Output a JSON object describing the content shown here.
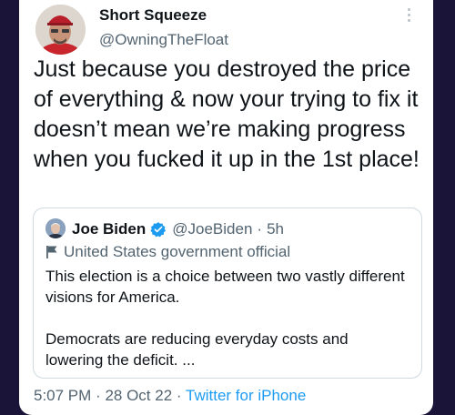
{
  "tweet": {
    "author_name": "Short Squeeze",
    "author_handle": "@OwningTheFloat",
    "text": "Just because you destroyed the price of everything & now your trying to fix it doesn’t mean we’re making progress when you fucked it up in the 1st place!",
    "more_icon": "more-vertical-icon",
    "time": "5:07 PM",
    "date": "28 Oct 22",
    "source": "Twitter for iPhone",
    "separator": "·"
  },
  "quoted_tweet": {
    "author_name": "Joe Biden",
    "author_handle": "@JoeBiden",
    "age": "5h",
    "label": "United States government official",
    "text": "This election is a choice between two vastly different visions for America.\n\nDemocrats are reducing everyday costs and lowering the deficit. ...",
    "verified_icon": "verified-badge-icon",
    "label_icon": "flag-icon",
    "verified_color": "#1d9bf0"
  },
  "colors": {
    "background": "#1a1438",
    "card": "#ffffff",
    "primary_text": "#0f1419",
    "secondary_text": "#536471",
    "link": "#1d9bf0",
    "border": "#cfd9de"
  }
}
